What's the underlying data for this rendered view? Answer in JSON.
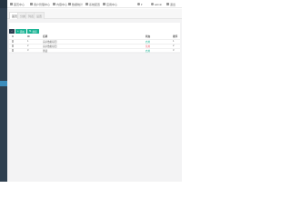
{
  "colors": {
    "sidebar": "#2f4050",
    "sidebar_active": "#3c8dbc",
    "accent_green": "#1ab394",
    "status_off": "#ed5565",
    "back_button": "#2c3e50"
  },
  "topbar": {
    "nav": [
      {
        "icon": "home-icon",
        "label": "首页中心"
      },
      {
        "icon": "user-icon",
        "label": "用户管理中心"
      },
      {
        "icon": "file-icon",
        "label": "内容中心"
      },
      {
        "icon": "list-icon",
        "label": "数据统计"
      },
      {
        "icon": "gear-icon",
        "label": "系统配置"
      },
      {
        "icon": "grid-icon",
        "label": "应用中心"
      }
    ],
    "right": [
      {
        "icon": "bell-icon",
        "label": "▾"
      },
      {
        "icon": "user-icon",
        "label": "admin"
      },
      {
        "icon": "logout-icon",
        "label": "退出"
      }
    ]
  },
  "tabs": [
    {
      "label": "首页",
      "active": true
    },
    {
      "label": "分类",
      "active": false
    },
    {
      "label": "列表",
      "active": false
    },
    {
      "label": "设置",
      "active": false
    }
  ],
  "toolbar": {
    "back_icon": "arrow-left-icon",
    "add_label": "添加",
    "add_icon": "plus-icon",
    "sort_label": "排序",
    "sort_icon": "sort-icon"
  },
  "table": {
    "headers": [
      "",
      "ID",
      "名称",
      "状态",
      "排序"
    ],
    "rows": [
      {
        "id": "1",
        "name": "演示数据项目",
        "status": "启用",
        "status_on": true,
        "sort": "1"
      },
      {
        "id": "2",
        "name": "演示数据项目",
        "status": "禁用",
        "status_on": false,
        "sort": "2"
      },
      {
        "id": "3",
        "name": "测试",
        "status": "启用",
        "status_on": true,
        "sort": "3"
      }
    ]
  }
}
